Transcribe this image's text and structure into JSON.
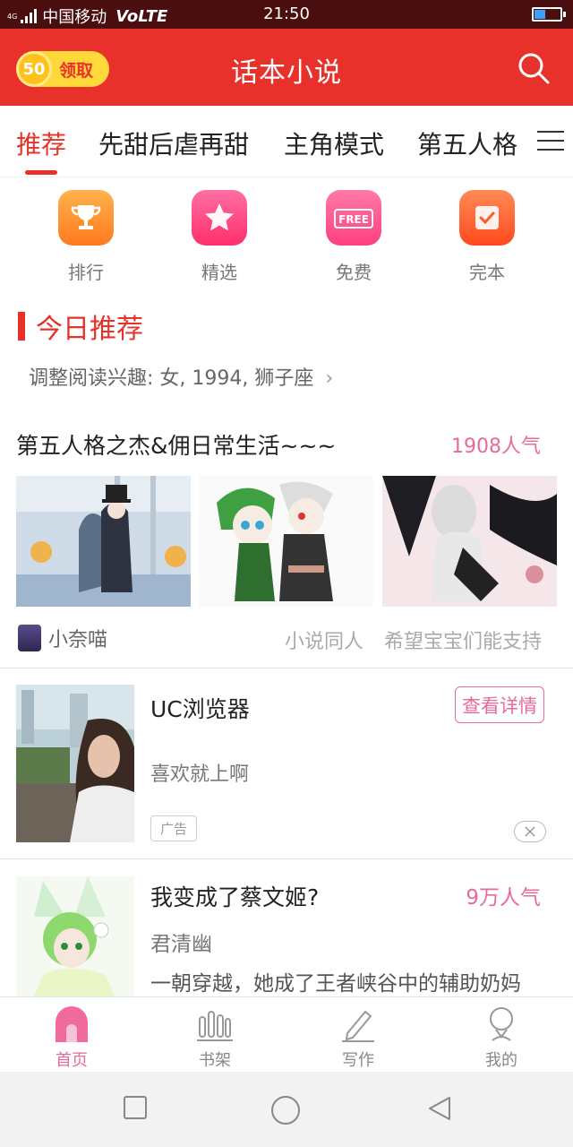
{
  "status_bar": {
    "network": "4G",
    "carrier": "中国移动",
    "volte": "VoLTE",
    "time": "21:50"
  },
  "header": {
    "coin_amount": "50",
    "claim_label": "领取",
    "title": "话本小说",
    "search_icon": "search-icon"
  },
  "tabs": [
    {
      "label": "推荐",
      "active": true
    },
    {
      "label": "先甜后虐再甜"
    },
    {
      "label": "主角模式"
    },
    {
      "label": "第五人格"
    }
  ],
  "categories": [
    {
      "label": "排行",
      "icon": "trophy-icon",
      "color": "#ff8a2a"
    },
    {
      "label": "精选",
      "icon": "star-icon",
      "color": "#ff3d7a"
    },
    {
      "label": "免费",
      "icon": "free-tag-icon",
      "color": "#ff4f8b"
    },
    {
      "label": "完本",
      "icon": "check-icon",
      "color": "#ff5a2c"
    }
  ],
  "section": {
    "title": "今日推荐",
    "preference": "调整阅读兴趣: 女, 1994, 狮子座",
    "preference_arrow": "›"
  },
  "featured": {
    "title": "第五人格之杰&佣日常生活~~~",
    "popularity": "1908人气",
    "author": "小奈喵",
    "tag": "小说同人",
    "note": "希望宝宝们能支持"
  },
  "ad": {
    "title": "UC浏览器",
    "button": "查看详情",
    "description": "喜欢就上啊",
    "badge": "广告"
  },
  "book": {
    "title": "我变成了蔡文姬?",
    "popularity": "9万人气",
    "author": "君清幽",
    "description": "一朝穿越，她成了王者峡谷中的辅助奶妈"
  },
  "bottom_nav": [
    {
      "label": "首页",
      "active": true
    },
    {
      "label": "书架"
    },
    {
      "label": "写作"
    },
    {
      "label": "我的"
    }
  ],
  "colors": {
    "brand_red": "#e8312b",
    "pink": "#e8699d",
    "status_bar": "#4a0e0e"
  }
}
